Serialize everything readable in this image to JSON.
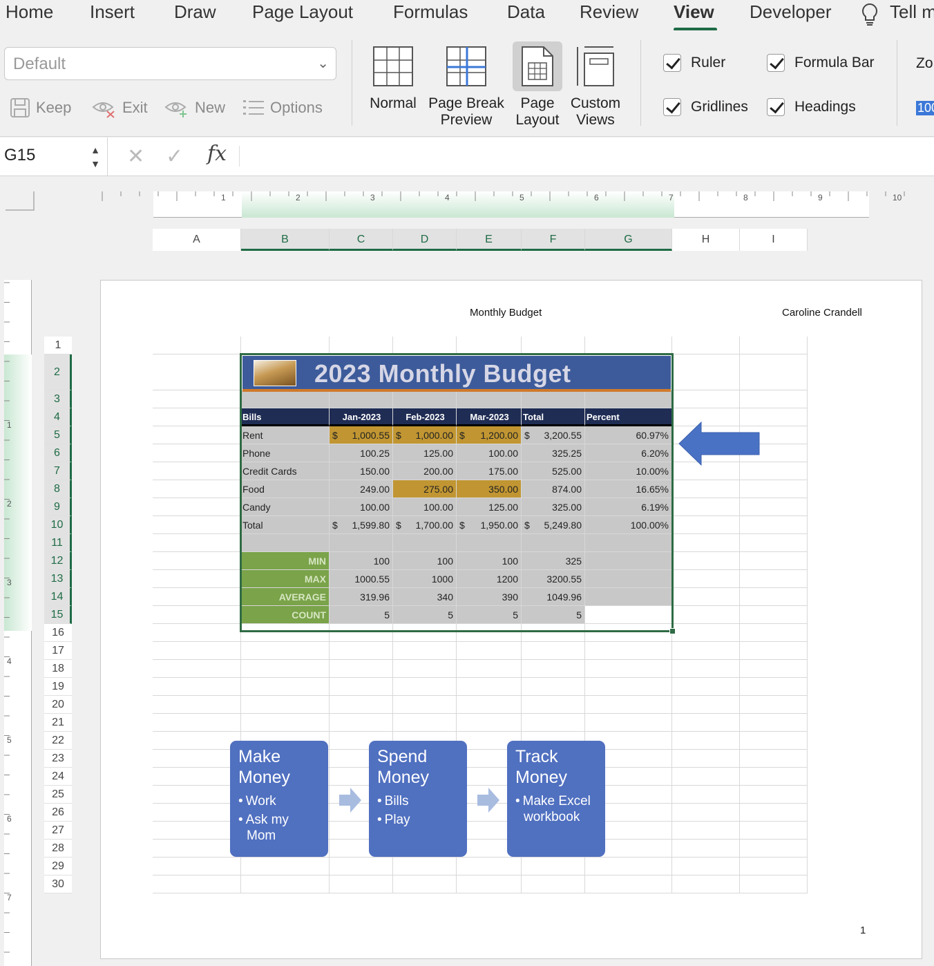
{
  "ribbon_tabs": [
    {
      "label": "Home"
    },
    {
      "label": "Insert"
    },
    {
      "label": "Draw"
    },
    {
      "label": "Page Layout"
    },
    {
      "label": "Formulas"
    },
    {
      "label": "Data"
    },
    {
      "label": "Review"
    },
    {
      "label": "View"
    },
    {
      "label": "Developer"
    },
    {
      "label": "Tell m"
    }
  ],
  "sheet_view": {
    "select_value": "Default",
    "keep": "Keep",
    "exit": "Exit",
    "new": "New",
    "options": "Options"
  },
  "workbook_views": {
    "normal": "Normal",
    "page_break_1": "Page Break",
    "page_break_2": "Preview",
    "page_layout_1": "Page",
    "page_layout_2": "Layout",
    "custom_1": "Custom",
    "custom_2": "Views"
  },
  "show": {
    "ruler": "Ruler",
    "formula_bar": "Formula Bar",
    "gridlines": "Gridlines",
    "headings": "Headings"
  },
  "zoom": {
    "label": "Zo",
    "value": "100"
  },
  "formula_bar": {
    "name_box": "G15",
    "fx": "fx",
    "value": ""
  },
  "ruler_h_numbers": [
    "1",
    "2",
    "3",
    "4",
    "5",
    "6",
    "7",
    "8",
    "9",
    "10"
  ],
  "ruler_v_numbers": [
    "1",
    "2",
    "3",
    "4",
    "5",
    "6",
    "7"
  ],
  "columns": [
    "A",
    "B",
    "C",
    "D",
    "E",
    "F",
    "G",
    "H",
    "I"
  ],
  "rows": [
    "1",
    "2",
    "3",
    "4",
    "5",
    "6",
    "7",
    "8",
    "9",
    "10",
    "11",
    "12",
    "13",
    "14",
    "15",
    "16",
    "17",
    "18",
    "19",
    "20",
    "21",
    "22",
    "23",
    "24",
    "25",
    "26",
    "27",
    "28",
    "29",
    "30"
  ],
  "header": {
    "center": "Monthly Budget",
    "right": "Caroline Crandell"
  },
  "footer": {
    "page_number": "1"
  },
  "budget": {
    "title": "2023 Monthly Budget",
    "headers": {
      "bills": "Bills",
      "jan": "Jan-2023",
      "feb": "Feb-2023",
      "mar": "Mar-2023",
      "total": "Total",
      "percent": "Percent"
    },
    "rows": [
      {
        "label": "Rent",
        "jan": "1,000.55",
        "feb": "1,000.00",
        "mar": "1,200.00",
        "total": "3,200.55",
        "percent": "60.97%"
      },
      {
        "label": "Phone",
        "jan": "100.25",
        "feb": "125.00",
        "mar": "100.00",
        "total": "325.25",
        "percent": "6.20%"
      },
      {
        "label": "Credit Cards",
        "jan": "150.00",
        "feb": "200.00",
        "mar": "175.00",
        "total": "525.00",
        "percent": "10.00%"
      },
      {
        "label": "Food",
        "jan": "249.00",
        "feb": "275.00",
        "mar": "350.00",
        "total": "874.00",
        "percent": "16.65%"
      },
      {
        "label": "Candy",
        "jan": "100.00",
        "feb": "100.00",
        "mar": "125.00",
        "total": "325.00",
        "percent": "6.19%"
      },
      {
        "label": "Total",
        "jan": "1,599.80",
        "feb": "1,700.00",
        "mar": "1,950.00",
        "total": "5,249.80",
        "percent": "100.00%"
      }
    ],
    "currency_symbol": "$",
    "stats": [
      {
        "label": "MIN",
        "jan": "100",
        "feb": "100",
        "mar": "100",
        "total": "325"
      },
      {
        "label": "MAX",
        "jan": "1000.55",
        "feb": "1000",
        "mar": "1200",
        "total": "3200.55"
      },
      {
        "label": "AVERAGE",
        "jan": "319.96",
        "feb": "340",
        "mar": "390",
        "total": "1049.96"
      },
      {
        "label": "COUNT",
        "jan": "5",
        "feb": "5",
        "mar": "5",
        "total": "5"
      }
    ]
  },
  "smartart": [
    {
      "title_1": "Make",
      "title_2": "Money",
      "items": [
        "Work",
        "Ask my Mom"
      ]
    },
    {
      "title_1": "Spend",
      "title_2": "Money",
      "items": [
        "Bills",
        "Play"
      ]
    },
    {
      "title_1": "Track",
      "title_2": "Money",
      "items": [
        "Make Excel workbook"
      ]
    }
  ],
  "colors": {
    "accent_green": "#1e6b45",
    "title_band": "#3d5b9a",
    "header_band": "#1f2d54",
    "highlight_gold": "#c19632",
    "stat_green": "#7aa34a",
    "table_gray": "#c8c8c8",
    "smartart_blue": "#5070c0",
    "arrow_blue": "#4a72c4"
  }
}
